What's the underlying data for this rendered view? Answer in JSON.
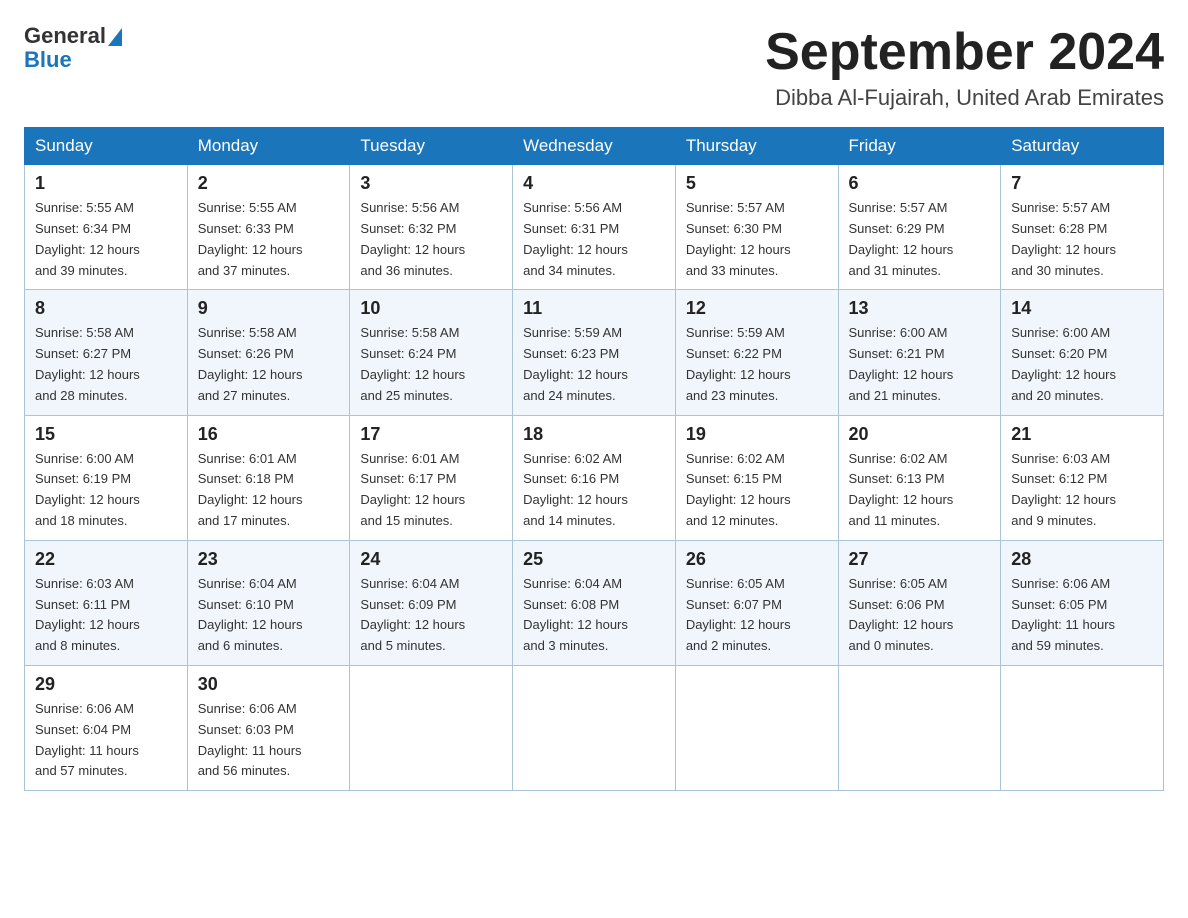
{
  "header": {
    "logo_general": "General",
    "logo_blue": "Blue",
    "month_title": "September 2024",
    "location": "Dibba Al-Fujairah, United Arab Emirates"
  },
  "weekdays": [
    "Sunday",
    "Monday",
    "Tuesday",
    "Wednesday",
    "Thursday",
    "Friday",
    "Saturday"
  ],
  "weeks": [
    [
      {
        "day": "1",
        "sunrise": "5:55 AM",
        "sunset": "6:34 PM",
        "daylight": "12 hours and 39 minutes."
      },
      {
        "day": "2",
        "sunrise": "5:55 AM",
        "sunset": "6:33 PM",
        "daylight": "12 hours and 37 minutes."
      },
      {
        "day": "3",
        "sunrise": "5:56 AM",
        "sunset": "6:32 PM",
        "daylight": "12 hours and 36 minutes."
      },
      {
        "day": "4",
        "sunrise": "5:56 AM",
        "sunset": "6:31 PM",
        "daylight": "12 hours and 34 minutes."
      },
      {
        "day": "5",
        "sunrise": "5:57 AM",
        "sunset": "6:30 PM",
        "daylight": "12 hours and 33 minutes."
      },
      {
        "day": "6",
        "sunrise": "5:57 AM",
        "sunset": "6:29 PM",
        "daylight": "12 hours and 31 minutes."
      },
      {
        "day": "7",
        "sunrise": "5:57 AM",
        "sunset": "6:28 PM",
        "daylight": "12 hours and 30 minutes."
      }
    ],
    [
      {
        "day": "8",
        "sunrise": "5:58 AM",
        "sunset": "6:27 PM",
        "daylight": "12 hours and 28 minutes."
      },
      {
        "day": "9",
        "sunrise": "5:58 AM",
        "sunset": "6:26 PM",
        "daylight": "12 hours and 27 minutes."
      },
      {
        "day": "10",
        "sunrise": "5:58 AM",
        "sunset": "6:24 PM",
        "daylight": "12 hours and 25 minutes."
      },
      {
        "day": "11",
        "sunrise": "5:59 AM",
        "sunset": "6:23 PM",
        "daylight": "12 hours and 24 minutes."
      },
      {
        "day": "12",
        "sunrise": "5:59 AM",
        "sunset": "6:22 PM",
        "daylight": "12 hours and 23 minutes."
      },
      {
        "day": "13",
        "sunrise": "6:00 AM",
        "sunset": "6:21 PM",
        "daylight": "12 hours and 21 minutes."
      },
      {
        "day": "14",
        "sunrise": "6:00 AM",
        "sunset": "6:20 PM",
        "daylight": "12 hours and 20 minutes."
      }
    ],
    [
      {
        "day": "15",
        "sunrise": "6:00 AM",
        "sunset": "6:19 PM",
        "daylight": "12 hours and 18 minutes."
      },
      {
        "day": "16",
        "sunrise": "6:01 AM",
        "sunset": "6:18 PM",
        "daylight": "12 hours and 17 minutes."
      },
      {
        "day": "17",
        "sunrise": "6:01 AM",
        "sunset": "6:17 PM",
        "daylight": "12 hours and 15 minutes."
      },
      {
        "day": "18",
        "sunrise": "6:02 AM",
        "sunset": "6:16 PM",
        "daylight": "12 hours and 14 minutes."
      },
      {
        "day": "19",
        "sunrise": "6:02 AM",
        "sunset": "6:15 PM",
        "daylight": "12 hours and 12 minutes."
      },
      {
        "day": "20",
        "sunrise": "6:02 AM",
        "sunset": "6:13 PM",
        "daylight": "12 hours and 11 minutes."
      },
      {
        "day": "21",
        "sunrise": "6:03 AM",
        "sunset": "6:12 PM",
        "daylight": "12 hours and 9 minutes."
      }
    ],
    [
      {
        "day": "22",
        "sunrise": "6:03 AM",
        "sunset": "6:11 PM",
        "daylight": "12 hours and 8 minutes."
      },
      {
        "day": "23",
        "sunrise": "6:04 AM",
        "sunset": "6:10 PM",
        "daylight": "12 hours and 6 minutes."
      },
      {
        "day": "24",
        "sunrise": "6:04 AM",
        "sunset": "6:09 PM",
        "daylight": "12 hours and 5 minutes."
      },
      {
        "day": "25",
        "sunrise": "6:04 AM",
        "sunset": "6:08 PM",
        "daylight": "12 hours and 3 minutes."
      },
      {
        "day": "26",
        "sunrise": "6:05 AM",
        "sunset": "6:07 PM",
        "daylight": "12 hours and 2 minutes."
      },
      {
        "day": "27",
        "sunrise": "6:05 AM",
        "sunset": "6:06 PM",
        "daylight": "12 hours and 0 minutes."
      },
      {
        "day": "28",
        "sunrise": "6:06 AM",
        "sunset": "6:05 PM",
        "daylight": "11 hours and 59 minutes."
      }
    ],
    [
      {
        "day": "29",
        "sunrise": "6:06 AM",
        "sunset": "6:04 PM",
        "daylight": "11 hours and 57 minutes."
      },
      {
        "day": "30",
        "sunrise": "6:06 AM",
        "sunset": "6:03 PM",
        "daylight": "11 hours and 56 minutes."
      },
      null,
      null,
      null,
      null,
      null
    ]
  ],
  "labels": {
    "sunrise": "Sunrise:",
    "sunset": "Sunset:",
    "daylight": "Daylight:"
  }
}
